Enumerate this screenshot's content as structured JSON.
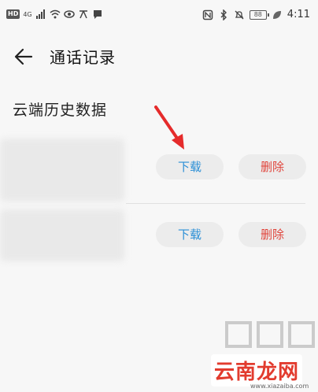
{
  "status_bar": {
    "left_badge": "HD",
    "signal_label": "4G",
    "battery": "88",
    "time": "4:11"
  },
  "header": {
    "title": "通话记录"
  },
  "section": {
    "title": "云端历史数据"
  },
  "records": [
    {
      "download_label": "下载",
      "delete_label": "删除"
    },
    {
      "download_label": "下载",
      "delete_label": "删除"
    }
  ],
  "watermark": {
    "logo_text": "云南龙网",
    "url_text": "www.xiazaiba.com"
  },
  "colors": {
    "download": "#2b8fd6",
    "delete": "#e0443b",
    "arrow": "#e52b2b"
  }
}
